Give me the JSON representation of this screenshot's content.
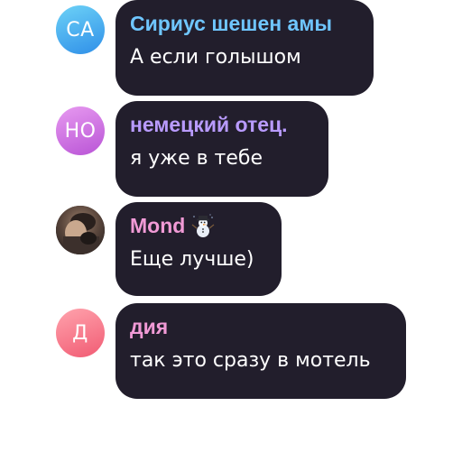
{
  "messages": [
    {
      "initials": "СА",
      "avatar_gradient": [
        "#6dd2f7",
        "#2f8fe8"
      ],
      "author": "Сириус шешен амы",
      "author_color": "#6fc6ff",
      "text": "А если голышом"
    },
    {
      "initials": "НО",
      "avatar_gradient": [
        "#e79af0",
        "#b954d6"
      ],
      "author": "немецкий отец.",
      "author_color": "#b99bff",
      "text": "я уже в тебе"
    },
    {
      "initials": "",
      "avatar_type": "photo",
      "author": "Mond",
      "author_color": "#f19ad6",
      "author_badge_icon": "snowman-icon",
      "text": "Еще лучше)"
    },
    {
      "initials": "Д",
      "avatar_gradient": [
        "#ffa3ad",
        "#f15b73"
      ],
      "author": "дия",
      "author_color": "#f19ad6",
      "text": "так это сразу в мотель"
    }
  ],
  "colors": {
    "bubble_bg": "#221e2c",
    "page_bg": "#ffffff",
    "message_text": "#ffffff"
  }
}
